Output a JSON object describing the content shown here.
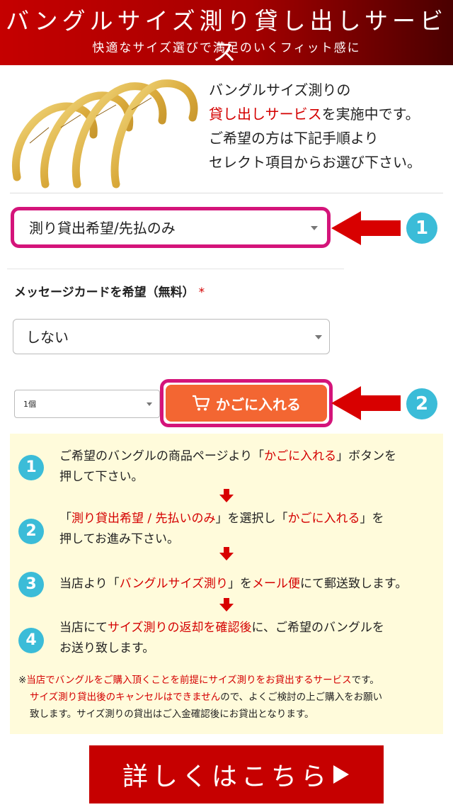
{
  "header": {
    "title": "バングルサイズ測り貸し出しサービス",
    "subtitle": "快適なサイズ選びで満足のいくフィット感に"
  },
  "intro": {
    "line1": "バングルサイズ測りの",
    "line2_red": "貸し出しサービス",
    "line2_rest": "を実施中です。",
    "line3": "ご希望の方は下記手順より",
    "line4": "セレクト項目からお選び下さい。",
    "image_icon": "gold-bangles-image"
  },
  "rental_select": {
    "value": "測り貸出希望/先払のみ"
  },
  "message_card": {
    "label": "メッセージカードを希望（無料）",
    "required_mark": "*",
    "value": "しない"
  },
  "quantity_select": {
    "value": "1個"
  },
  "cart_button": {
    "label": "かごに入れる",
    "icon": "cart-icon"
  },
  "badges": {
    "one": "1",
    "two": "2"
  },
  "steps": [
    {
      "num": "1",
      "parts": [
        "ご希望のバングルの商品ページより「",
        "かごに入れる",
        "」ボタンを"
      ],
      "line2": "押して下さい。"
    },
    {
      "num": "2",
      "parts": [
        "「",
        "測り貸出希望 / 先払いのみ",
        "」を選択し「",
        "かごに入れる",
        "」を"
      ],
      "line2": "押してお進み下さい。"
    },
    {
      "num": "3",
      "parts": [
        "当店より「",
        "バングルサイズ測り",
        "」を",
        "メール便",
        "にて郵送致します。"
      ]
    },
    {
      "num": "4",
      "parts": [
        "当店にて",
        "サイズ測りの返却を確認後",
        "に、ご希望のバングルを"
      ],
      "line2": "お送り致します。"
    }
  ],
  "note": {
    "prefix": "※",
    "red1": "当店でバングルをご購入頂くことを前提にサイズ測りをお貸出するサービス",
    "text1": "です。",
    "red2": "サイズ測り貸出後のキャンセルはできません",
    "text2": "ので、よくご検討の上ご購入をお願い",
    "text3": "致します。サイズ測りの貸出はご入金確認後にお貸出となります。"
  },
  "more_button": {
    "label": "詳しくはこちら",
    "icon": "play-triangle-icon"
  },
  "colors": {
    "brand_red": "#c60000",
    "accent_red": "#d40000",
    "highlight_pink": "#d4147a",
    "badge_cyan": "#3bbcd8",
    "cart_orange": "#f36632",
    "steps_bg": "#fffbdb"
  }
}
